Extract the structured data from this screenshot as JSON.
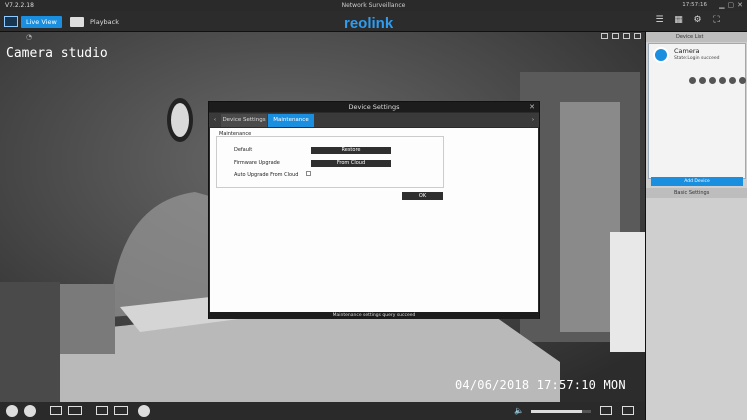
{
  "titlebar": {
    "version": "V7.2.2.18",
    "app_title": "Network Surveillance",
    "time": "17:57:16"
  },
  "toolbar": {
    "live_label": "Live View",
    "playback_label": "Playback",
    "logo_text": "reolink"
  },
  "video": {
    "camera_name": "Camera studio",
    "osd_time": "04/06/2018 17:57:10 MON"
  },
  "sidebar": {
    "device_list_label": "Device List",
    "camera": {
      "name": "Camera",
      "status": "State:Login succeed"
    },
    "add_device_label": "Add Device",
    "basic_settings_label": "Basic Settings"
  },
  "dialog": {
    "title": "Device Settings",
    "tabs": [
      "Device Settings",
      "Maintenance"
    ],
    "group_label": "Maintenance",
    "rows": [
      {
        "label": "Default",
        "button": "Restore"
      },
      {
        "label": "Firmware Upgrade",
        "button": "From Cloud"
      },
      {
        "label": "Auto Upgrade From Cloud"
      }
    ],
    "ok_label": "OK",
    "status": "Maintenance settings query succeed"
  },
  "colors": {
    "accent": "#1a8fe0",
    "dark": "#2b2b2b"
  },
  "volume": {
    "level": 0.85
  }
}
